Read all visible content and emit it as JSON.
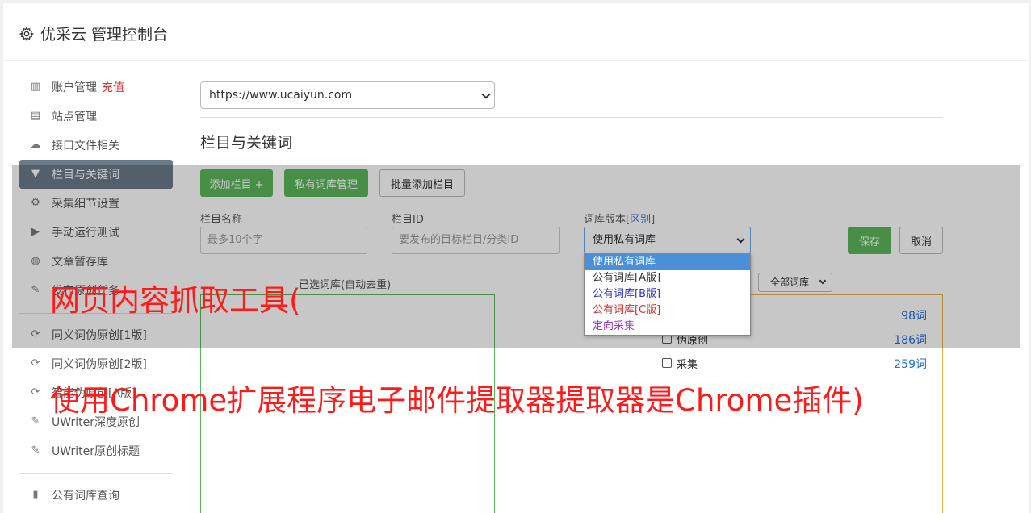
{
  "header": {
    "title": "优采云 管理控制台"
  },
  "sidebar": {
    "items": [
      {
        "label": "账户管理",
        "icon": "bar-chart-icon",
        "extra": "充值"
      },
      {
        "label": "站点管理",
        "icon": "server-icon"
      },
      {
        "label": "接口文件相关",
        "icon": "cloud-upload-icon"
      },
      {
        "label": "栏目与关键词",
        "icon": "filter-icon",
        "active": true
      },
      {
        "label": "采集细节设置",
        "icon": "gears-icon"
      },
      {
        "label": "手动运行测试",
        "icon": "play-icon"
      },
      {
        "label": "文章暂存库",
        "icon": "database-icon"
      },
      {
        "label": "发布原创任务",
        "icon": "edit-icon"
      },
      {
        "label": "同义词伪原创[1版]",
        "icon": "refresh-icon"
      },
      {
        "label": "同义词伪原创[2版]",
        "icon": "refresh-icon"
      },
      {
        "label": "智能伪原创[A版]",
        "icon": "refresh-icon"
      },
      {
        "label": "UWriter深度原创",
        "icon": "edit-icon"
      },
      {
        "label": "UWriter原创标题",
        "icon": "edit-icon"
      },
      {
        "label": "公有词库查询",
        "icon": "book-icon"
      }
    ]
  },
  "main": {
    "site_select": "https://www.ucaiyun.com",
    "section_title": "栏目与关键词",
    "buttons": {
      "add_column": "添加栏目 +",
      "private_lib": "私有词库管理",
      "batch_add": "批量添加栏目",
      "save": "保存",
      "cancel": "取消"
    },
    "form": {
      "column_name_label": "栏目名称",
      "column_name_placeholder": "最多10个字",
      "column_id_label": "栏目ID",
      "column_id_placeholder": "要发布的目标栏目/分类ID",
      "lib_version_label": "词库版本",
      "lib_version_bracket": "[区别]",
      "lib_version_value": "使用私有词库"
    },
    "dropdown_options": [
      {
        "label": "使用私有词库",
        "color": "#ffffff",
        "selected": true
      },
      {
        "label": "公有词库[A版]",
        "color": "#333333"
      },
      {
        "label": "公有词库[B版]",
        "color": "#3333cc"
      },
      {
        "label": "公有词库[C版]",
        "color": "#cc3333"
      },
      {
        "label": "定向采集",
        "color": "#9933cc"
      }
    ],
    "selected_lib_label": "已选词库(自动去重)",
    "filter_select": "全部词库",
    "libraries": [
      {
        "name": "",
        "count": "98词"
      },
      {
        "name": "伪原创",
        "count": "186词"
      },
      {
        "name": "采集",
        "count": "259词"
      }
    ]
  },
  "captions": {
    "line1": "网页内容抓取工具(",
    "line2": "使用Chrome扩展程序电子邮件提取器提取器是Chrome插件)"
  }
}
